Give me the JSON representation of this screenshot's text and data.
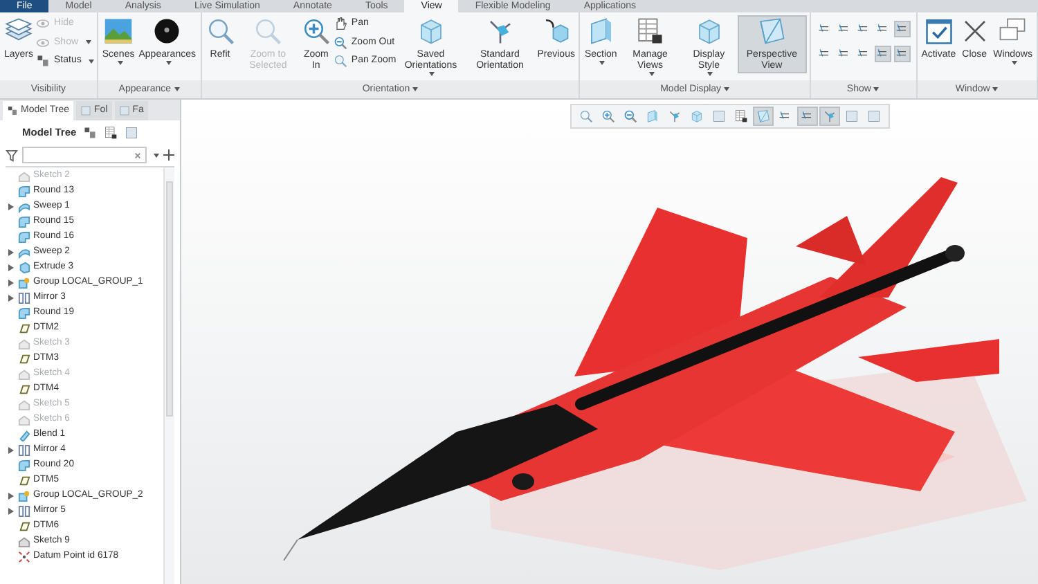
{
  "tabs": [
    {
      "label": "File",
      "kind": "file",
      "selected": false
    },
    {
      "label": "Model",
      "kind": "tab",
      "selected": false
    },
    {
      "label": "Analysis",
      "kind": "tab",
      "selected": false
    },
    {
      "label": "Live Simulation",
      "kind": "tab",
      "selected": false
    },
    {
      "label": "Annotate",
      "kind": "tab",
      "selected": false
    },
    {
      "label": "Tools",
      "kind": "tab",
      "selected": false
    },
    {
      "label": "View",
      "kind": "tab",
      "selected": true
    },
    {
      "label": "Flexible Modeling",
      "kind": "tab",
      "selected": false
    },
    {
      "label": "Applications",
      "kind": "tab",
      "selected": false
    }
  ],
  "ribbon": {
    "groups": [
      {
        "label": "Visibility",
        "menu": false,
        "buttons": [
          {
            "label": "Layers",
            "kind": "large",
            "disabled": false,
            "menu": false
          },
          {
            "label": "Hide",
            "kind": "small",
            "disabled": true,
            "menu": false
          },
          {
            "label": "Show",
            "kind": "small",
            "disabled": true,
            "menu": true
          },
          {
            "label": "Status",
            "kind": "small",
            "disabled": false,
            "menu": true
          }
        ]
      },
      {
        "label": "Appearance",
        "menu": true,
        "buttons": [
          {
            "label": "Scenes",
            "kind": "large",
            "disabled": false,
            "menu": true
          },
          {
            "label": "Appearances",
            "kind": "large",
            "disabled": false,
            "menu": true
          }
        ]
      },
      {
        "label": "Orientation",
        "menu": true,
        "buttons": [
          {
            "label": "Refit",
            "kind": "large",
            "disabled": false,
            "menu": false
          },
          {
            "label": "Zoom to Selected",
            "kind": "large",
            "disabled": true,
            "menu": false
          },
          {
            "label": "Zoom In",
            "kind": "large",
            "disabled": false,
            "menu": false
          },
          {
            "label": "Pan",
            "kind": "small",
            "disabled": false,
            "menu": false
          },
          {
            "label": "Zoom Out",
            "kind": "small",
            "disabled": false,
            "menu": false
          },
          {
            "label": "Pan Zoom",
            "kind": "small",
            "disabled": false,
            "menu": false
          },
          {
            "label": "Saved Orientations",
            "kind": "large",
            "disabled": false,
            "menu": true
          },
          {
            "label": "Standard Orientation",
            "kind": "large",
            "disabled": false,
            "menu": false
          },
          {
            "label": "Previous",
            "kind": "large",
            "disabled": false,
            "menu": false
          }
        ]
      },
      {
        "label": "Model Display",
        "menu": true,
        "buttons": [
          {
            "label": "Section",
            "kind": "large",
            "disabled": false,
            "menu": true
          },
          {
            "label": "Manage Views",
            "kind": "large",
            "disabled": false,
            "menu": true
          },
          {
            "label": "Display Style",
            "kind": "large",
            "disabled": false,
            "menu": true
          },
          {
            "label": "Perspective View",
            "kind": "large",
            "disabled": false,
            "menu": false,
            "on": true
          }
        ]
      },
      {
        "label": "Show",
        "menu": true,
        "toggles": [
          {
            "selected": false
          },
          {
            "selected": false
          },
          {
            "selected": false
          },
          {
            "selected": false
          },
          {
            "selected": true
          },
          {
            "selected": false
          },
          {
            "selected": false
          },
          {
            "selected": false
          },
          {
            "selected": true
          },
          {
            "selected": true
          }
        ]
      },
      {
        "label": "Window",
        "menu": true,
        "buttons": [
          {
            "label": "Activate",
            "kind": "large",
            "disabled": false,
            "menu": false
          },
          {
            "label": "Close",
            "kind": "large",
            "disabled": false,
            "menu": false
          },
          {
            "label": "Windows",
            "kind": "large",
            "disabled": false,
            "menu": true
          }
        ]
      }
    ]
  },
  "panel": {
    "tabs": [
      {
        "label": "Model Tree",
        "selected": true
      },
      {
        "label": "Fol",
        "selected": false
      },
      {
        "label": "Fa",
        "selected": false
      }
    ],
    "header": "Model Tree",
    "tree": [
      {
        "label": "Sketch 2",
        "kind": "sketch",
        "disabled": true
      },
      {
        "label": "Round 13",
        "kind": "round",
        "disabled": false
      },
      {
        "label": "Sweep 1",
        "kind": "sweep",
        "disabled": false,
        "expanded": false
      },
      {
        "label": "Round 15",
        "kind": "round",
        "disabled": false
      },
      {
        "label": "Round 16",
        "kind": "round",
        "disabled": false
      },
      {
        "label": "Sweep 2",
        "kind": "sweep",
        "disabled": false,
        "expanded": false
      },
      {
        "label": "Extrude 3",
        "kind": "extrude",
        "disabled": false,
        "expanded": false
      },
      {
        "label": "Group LOCAL_GROUP_1",
        "kind": "group",
        "disabled": false,
        "expanded": false
      },
      {
        "label": "Mirror 3",
        "kind": "mirror",
        "disabled": false,
        "expanded": false
      },
      {
        "label": "Round 19",
        "kind": "round",
        "disabled": false
      },
      {
        "label": "DTM2",
        "kind": "plane",
        "disabled": false
      },
      {
        "label": "Sketch 3",
        "kind": "sketch",
        "disabled": true
      },
      {
        "label": "DTM3",
        "kind": "plane",
        "disabled": false
      },
      {
        "label": "Sketch 4",
        "kind": "sketch",
        "disabled": true
      },
      {
        "label": "DTM4",
        "kind": "plane",
        "disabled": false
      },
      {
        "label": "Sketch 5",
        "kind": "sketch",
        "disabled": true
      },
      {
        "label": "Sketch 6",
        "kind": "sketch",
        "disabled": true
      },
      {
        "label": "Blend 1",
        "kind": "blend",
        "disabled": false
      },
      {
        "label": "Mirror 4",
        "kind": "mirror",
        "disabled": false,
        "expanded": false
      },
      {
        "label": "Round 20",
        "kind": "round",
        "disabled": false
      },
      {
        "label": "DTM5",
        "kind": "plane",
        "disabled": false
      },
      {
        "label": "Group LOCAL_GROUP_2",
        "kind": "group",
        "disabled": false,
        "expanded": false
      },
      {
        "label": "Mirror 5",
        "kind": "mirror",
        "disabled": false,
        "expanded": false
      },
      {
        "label": "DTM6",
        "kind": "plane",
        "disabled": false
      },
      {
        "label": "Sketch 9",
        "kind": "sketch",
        "disabled": false
      },
      {
        "label": "Datum Point id 6178",
        "kind": "point",
        "disabled": false
      }
    ]
  },
  "view_toolbar": [
    {
      "selected": false
    },
    {
      "selected": false
    },
    {
      "selected": false
    },
    {
      "selected": false
    },
    {
      "selected": false
    },
    {
      "selected": false
    },
    {
      "selected": false
    },
    {
      "selected": false
    },
    {
      "selected": true
    },
    {
      "selected": false
    },
    {
      "selected": true
    },
    {
      "selected": true
    },
    {
      "selected": false
    },
    {
      "selected": false
    }
  ]
}
